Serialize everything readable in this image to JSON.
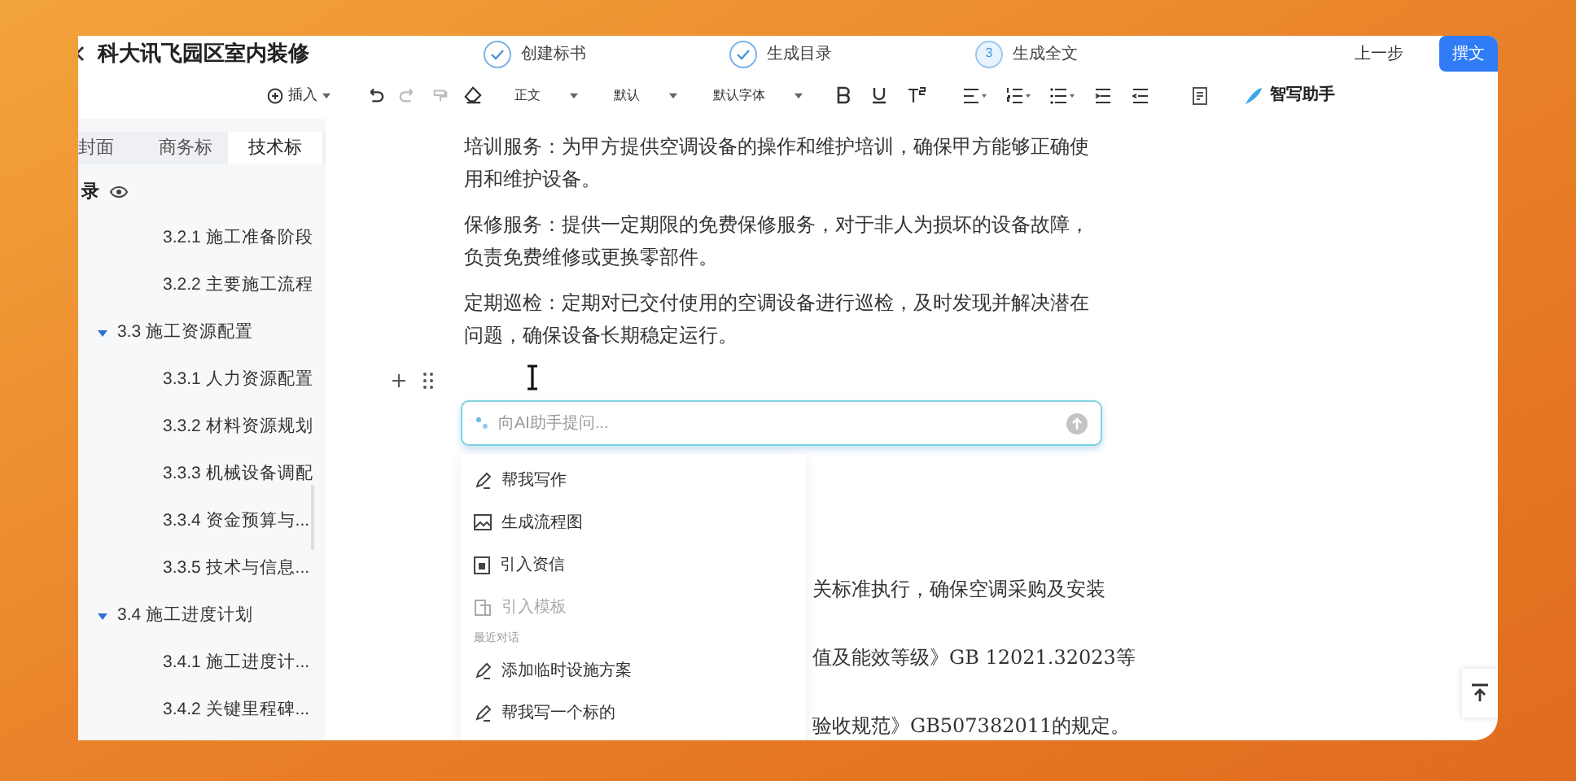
{
  "window": {
    "title": "科大讯飞园区室内装修"
  },
  "steps": [
    {
      "label": "创建标书",
      "completed": true
    },
    {
      "label": "生成目录",
      "completed": true
    },
    {
      "label": "生成全文",
      "number": "3",
      "completed": false
    }
  ],
  "header_buttons": [
    {
      "label": "上一步",
      "kind": "plain"
    },
    {
      "label": "撰文",
      "kind": "primary"
    }
  ],
  "toolbar": {
    "insert": "插入",
    "selects": [
      "正文",
      "默认",
      "默认字体"
    ],
    "assistant": "智写助手"
  },
  "sidebar": {
    "tabs": [
      {
        "label": "封面",
        "selected": false
      },
      {
        "label": "商务标",
        "selected": false
      },
      {
        "label": "技术标",
        "selected": true
      }
    ],
    "outline_title": "录",
    "continued_items": [
      {
        "label": "3.2.1 施工准备阶段"
      },
      {
        "label": "3.2.2 主要施工流程"
      }
    ],
    "items": [
      {
        "label": "3.3 施工资源配置",
        "expanded": true,
        "children": [
          {
            "label": "3.3.1 人力资源配置"
          },
          {
            "label": "3.3.2 材料资源规划"
          },
          {
            "label": "3.3.3 机械设备调配"
          },
          {
            "label": "3.3.4 资金预算与..."
          },
          {
            "label": "3.3.5 技术与信息..."
          }
        ]
      },
      {
        "label": "3.4 施工进度计划",
        "expanded": true,
        "children": [
          {
            "label": "3.4.1 施工进度计..."
          },
          {
            "label": "3.4.2 关键里程碑..."
          }
        ]
      }
    ]
  },
  "editor": {
    "paragraphs": [
      "培训服务：为甲方提供空调设备的操作和维护培训，确保甲方能够正确使用和维护设备。",
      "保修服务：提供一定期限的免费保修服务，对于非人为损坏的设备故障，负责免费维修或更换零部件。",
      "定期巡检：定期对已交付使用的空调设备进行巡检，及时发现并解决潜在问题，确保设备长期稳定运行。"
    ],
    "ai_prompt": {
      "placeholder": "向AI助手提问..."
    },
    "partial_lines": [
      "关标准执行，确保空调采购及安装",
      "值及能效等级》GB 12021.32023等",
      "验收规范》GB507382011的规定。"
    ]
  },
  "ai_menu": {
    "actions": [
      {
        "label": "帮我写作",
        "kind": "write",
        "disabled": false
      },
      {
        "label": "生成流程图",
        "kind": "image",
        "disabled": false
      },
      {
        "label": "引入资信",
        "kind": "document",
        "disabled": false
      },
      {
        "label": "引入模板",
        "kind": "template",
        "disabled": true
      }
    ],
    "recent_title": "最近对话",
    "recent": [
      {
        "label": "添加临时设施方案",
        "kind": "write",
        "disabled": false
      },
      {
        "label": "帮我写一个标的",
        "kind": "write",
        "disabled": false
      }
    ]
  }
}
